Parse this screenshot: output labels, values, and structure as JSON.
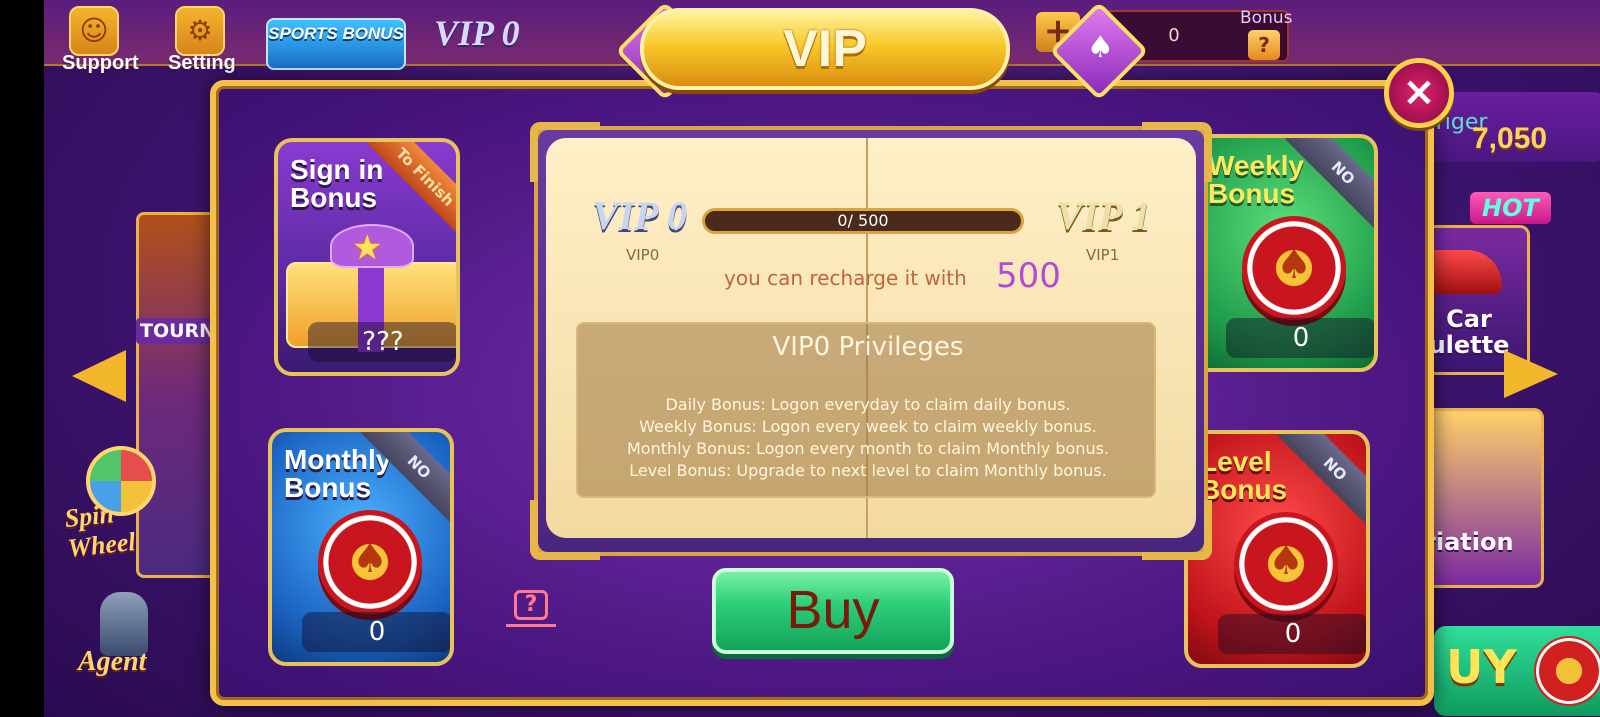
{
  "topbar": {
    "support_label": "Support",
    "setting_label": "Setting",
    "sports_bonus_label": "SPORTS BONUS",
    "vip_level": "VIP 0",
    "balance_value": "0",
    "bonus_label": "Bonus",
    "help_symbol": "?",
    "plus_symbol": "+"
  },
  "background": {
    "tournament_label": "TOURNA",
    "spin_wheel_label": "Spin Wheel",
    "agent_label": "Agent",
    "tiger_label": "Tiger",
    "tiger_amount": "7,050",
    "hot_badge": "HOT",
    "car_roulette_label": "Car\nulette",
    "variation_label": "riation",
    "buy_label": "UY"
  },
  "modal": {
    "title": "VIP",
    "close_symbol": "×",
    "cards": {
      "signin": {
        "title": "Sign in Bonus",
        "ribbon": "To Finish",
        "value": "???"
      },
      "weekly": {
        "title": "Weekly Bonus",
        "ribbon": "NO",
        "value": "0"
      },
      "monthly": {
        "title": "Monthly Bonus",
        "ribbon": "NO",
        "value": "0"
      },
      "level": {
        "title": "Level Bonus",
        "ribbon": "NO",
        "value": "0"
      }
    },
    "book": {
      "current_vip": "VIP 0",
      "next_vip": "VIP 1",
      "current_vip_small": "VIP0",
      "next_vip_small": "VIP1",
      "progress_text": "0/ 500",
      "progress_fraction": 0,
      "recharge_text": "you can recharge it with",
      "recharge_amount": "500",
      "privileges_title": "VIP0 Privileges",
      "privileges": [
        "Daily Bonus: Logon everyday to claim daily bonus.",
        "Weekly Bonus: Logon every week to claim weekly bonus.",
        "Monthly Bonus: Logon every month to claim Monthly bonus.",
        "Level Bonus: Upgrade to next level to claim Monthly bonus."
      ]
    },
    "help_symbol": "?",
    "buy_label": "Buy"
  },
  "colors": {
    "accent_gold": "#f3c14a",
    "modal_purple": "#4a1680",
    "buy_green": "#2ecf7a",
    "recharge_purple": "#b04ad8"
  },
  "icons": [
    "support-icon",
    "gear-icon",
    "spade-icon",
    "gift-icon",
    "chip-icon",
    "help-book-icon",
    "close-icon",
    "left-arrow-icon",
    "right-arrow-icon"
  ]
}
